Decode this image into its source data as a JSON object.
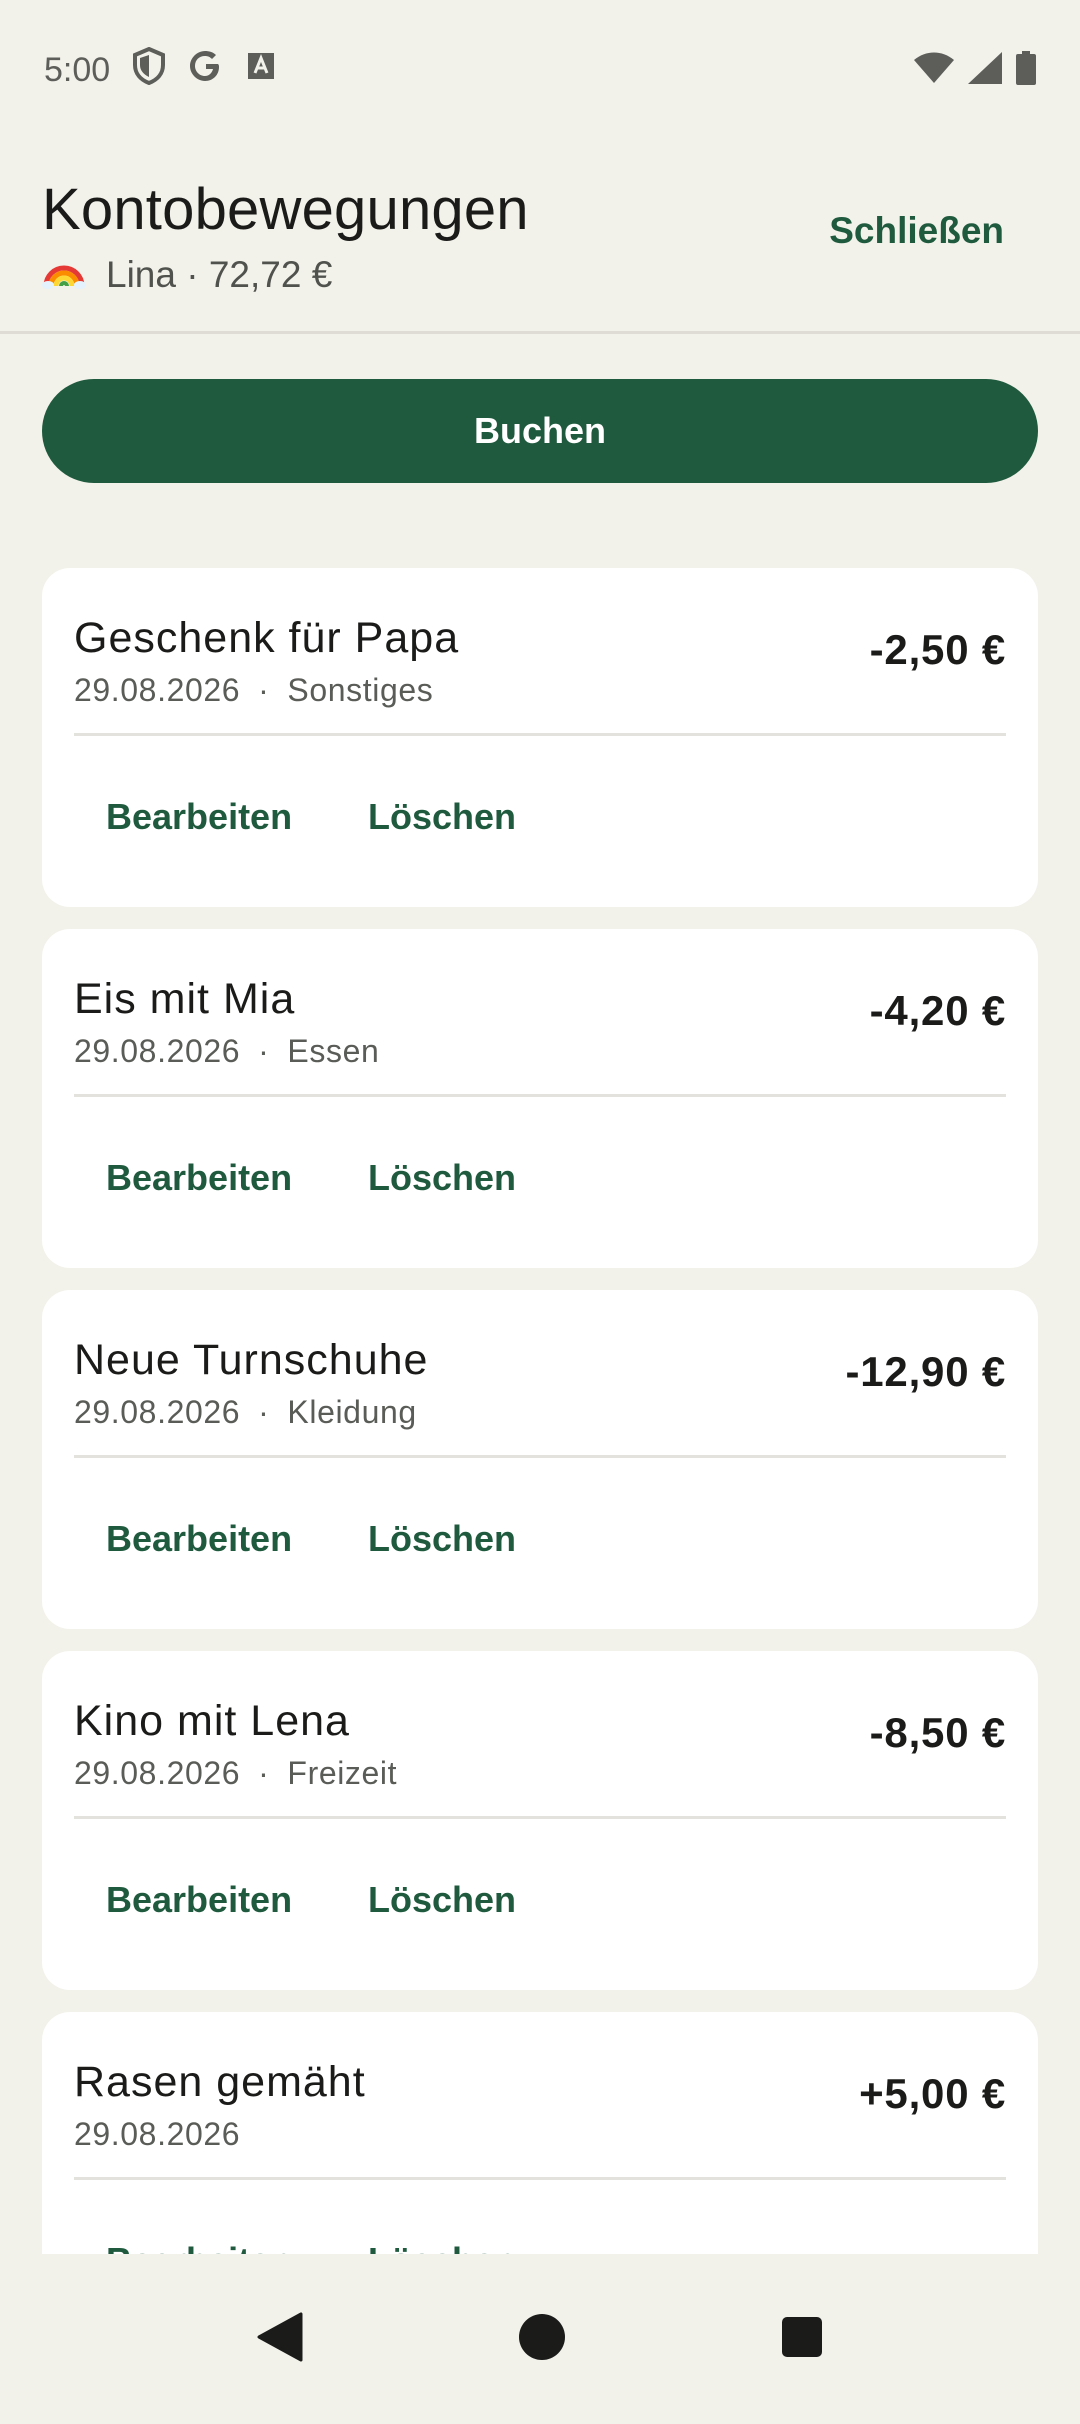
{
  "status_bar": {
    "time": "5:00",
    "left_icons": [
      "shield-icon",
      "google-icon",
      "font-icon"
    ],
    "right_icons": [
      "wifi-icon",
      "cellular-icon",
      "battery-icon"
    ]
  },
  "header": {
    "title": "Kontobewegungen",
    "avatar_icon": "rainbow-icon",
    "subtitle": "Lina · 72,72 €",
    "close_label": "Schließen"
  },
  "book_button_label": "Buchen",
  "transactions": [
    {
      "title": "Geschenk für Papa",
      "date": "29.08.2026",
      "separator": "·",
      "category": "Sonstiges",
      "amount": "-2,50 €",
      "edit_label": "Bearbeiten",
      "delete_label": "Löschen"
    },
    {
      "title": "Eis mit Mia",
      "date": "29.08.2026",
      "separator": "·",
      "category": "Essen",
      "amount": "-4,20 €",
      "edit_label": "Bearbeiten",
      "delete_label": "Löschen"
    },
    {
      "title": "Neue Turnschuhe",
      "date": "29.08.2026",
      "separator": "·",
      "category": "Kleidung",
      "amount": "-12,90 €",
      "edit_label": "Bearbeiten",
      "delete_label": "Löschen"
    },
    {
      "title": "Kino mit Lena",
      "date": "29.08.2026",
      "separator": "·",
      "category": "Freizeit",
      "amount": "-8,50 €",
      "edit_label": "Bearbeiten",
      "delete_label": "Löschen"
    },
    {
      "title": "Rasen gemäht",
      "date": "29.08.2026",
      "amount": "+5,00 €",
      "edit_label": "Bearbeiten",
      "delete_label": "Löschen"
    }
  ],
  "colors": {
    "background": "#f2f1ea",
    "accent": "#1f5a3e",
    "card": "#ffffff",
    "text": "#1b1c1a"
  },
  "nav_bar": {
    "icons": [
      "back-icon",
      "home-icon",
      "recents-icon"
    ]
  }
}
